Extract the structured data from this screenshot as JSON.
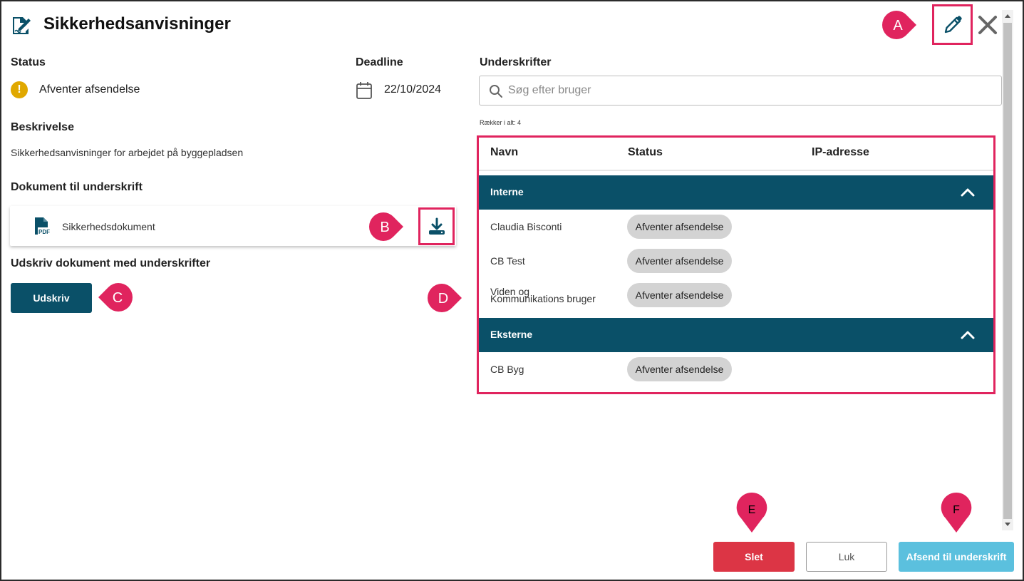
{
  "dialog": {
    "title": "Sikkerhedsanvisninger",
    "status": {
      "label": "Status",
      "value": "Afventer afsendelse",
      "icon": "warning-icon",
      "color": "#e0a800"
    },
    "deadline": {
      "label": "Deadline",
      "value": "22/10/2024",
      "icon": "calendar-icon"
    },
    "description": {
      "label": "Beskrivelse",
      "value": "Sikkerhedsanvisninger for arbejdet på byggepladsen"
    },
    "document": {
      "label": "Dokument til underskrift",
      "name": "Sikkerhedsdokument",
      "icon": "pdf-icon",
      "download_icon": "download-icon"
    },
    "print": {
      "label": "Udskriv dokument med underskrifter",
      "button": "Udskriv"
    },
    "signatures": {
      "label": "Underskrifter",
      "search_placeholder": "Søg efter bruger",
      "row_count": "Rækker i alt: 4",
      "columns": [
        "Navn",
        "Status",
        "IP-adresse"
      ],
      "groups": [
        {
          "name": "Interne",
          "rows": [
            {
              "name": "Claudia Bisconti",
              "status": "Afventer afsendelse",
              "ip": ""
            },
            {
              "name": "CB Test",
              "status": "Afventer afsendelse",
              "ip": ""
            },
            {
              "name_line1": "Viden og",
              "name_line2": "Kommunikations bruger",
              "status": "Afventer afsendelse",
              "ip": ""
            }
          ]
        },
        {
          "name": "Eksterne",
          "rows": [
            {
              "name": "CB Byg",
              "status": "Afventer afsendelse",
              "ip": ""
            }
          ]
        }
      ]
    },
    "footer": {
      "delete": "Slet",
      "close": "Luk",
      "send": "Afsend til underskrift"
    },
    "colors": {
      "primary": "#0a5068",
      "danger": "#dc3545",
      "info": "#5bc0de",
      "highlight": "#e0245e"
    }
  },
  "callouts": {
    "a": "A",
    "b": "B",
    "c": "C",
    "d": "D",
    "e": "E",
    "f": "F"
  }
}
